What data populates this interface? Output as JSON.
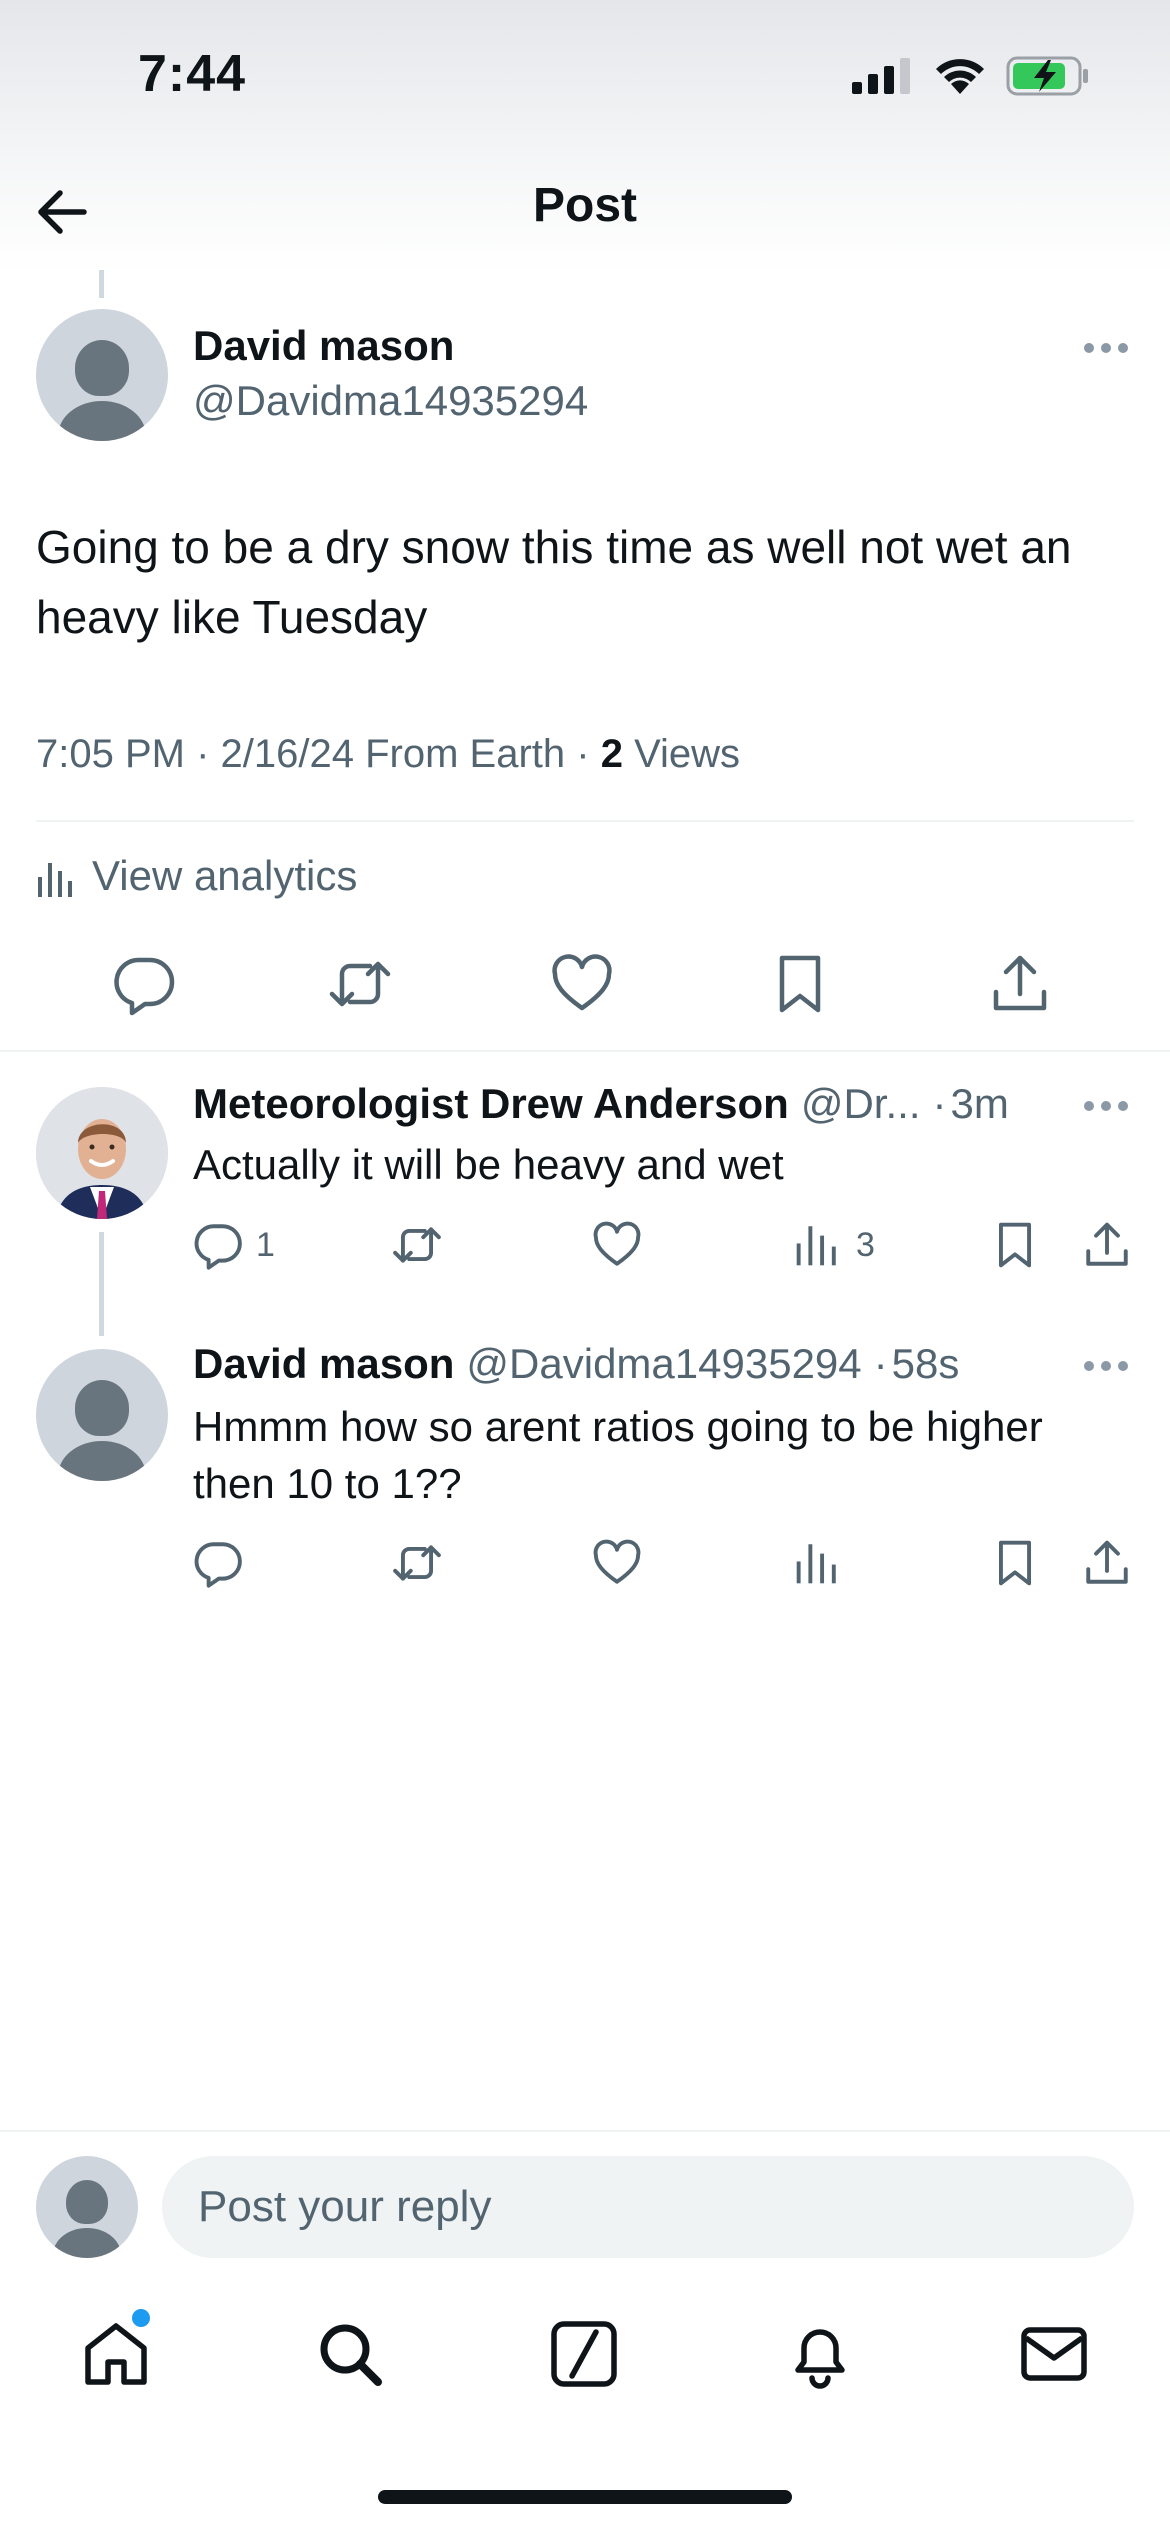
{
  "status_bar": {
    "time": "7:44"
  },
  "header": {
    "title": "Post"
  },
  "main_post": {
    "name": "David mason",
    "handle": "@Davidma14935294",
    "text": "Going to be a dry snow this time as well  not wet an heavy like Tuesday",
    "time": "7:05 PM",
    "date": "2/16/24",
    "source": "From Earth",
    "views_count": "2",
    "views_label": "Views",
    "analytics_label": "View analytics"
  },
  "replies": [
    {
      "name": "Meteorologist Drew Anderson",
      "handle": "@Dr...",
      "time": "3m",
      "text": "Actually it will be heavy and wet",
      "reply_count": "1",
      "views_count": "3"
    },
    {
      "name": "David mason",
      "handle": "@Davidma14935294",
      "time": "58s",
      "text": "Hmmm how so arent ratios going to be higher then 10 to 1??",
      "reply_count": "",
      "views_count": ""
    }
  ],
  "compose": {
    "placeholder": "Post your reply"
  },
  "bottom_nav": {
    "items": [
      "home-icon",
      "search-icon",
      "grok-icon",
      "notifications-icon",
      "messages-icon"
    ]
  },
  "colors": {
    "text_primary": "#0f1419",
    "text_secondary": "#536471",
    "divider": "#eff3f4",
    "accent": "#1d9bf0"
  }
}
